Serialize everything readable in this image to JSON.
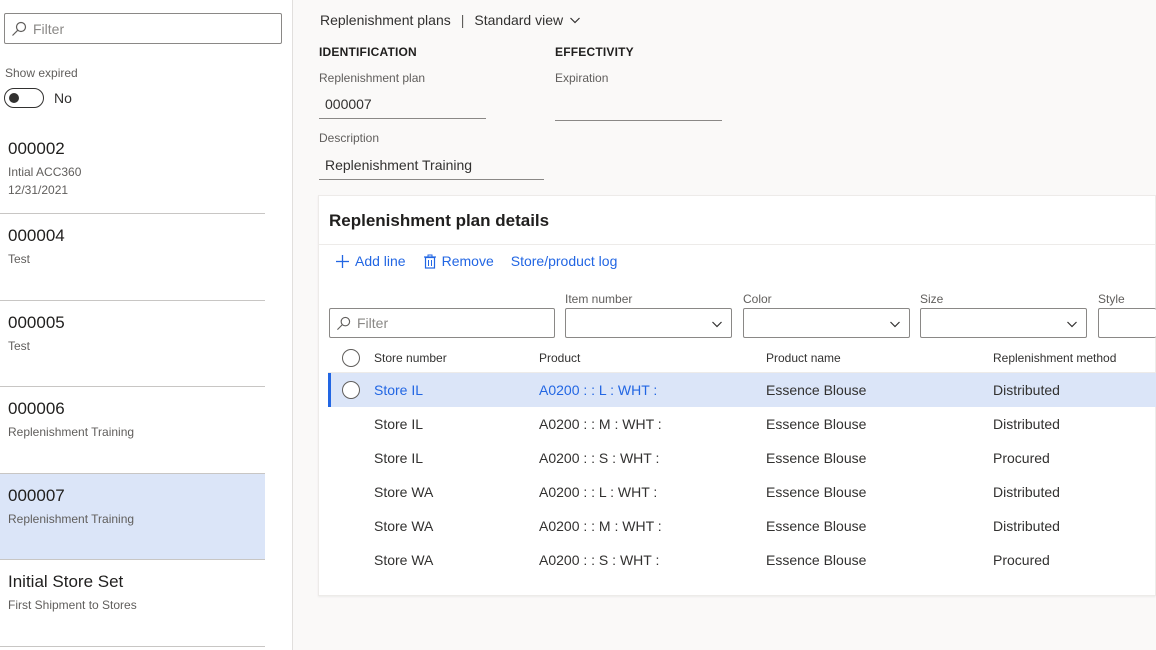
{
  "left_pane": {
    "filter_placeholder": "Filter",
    "show_expired_label": "Show expired",
    "show_expired_value": "No",
    "items": [
      {
        "title": "000002",
        "line1": "Intial ACC360",
        "line2": "12/31/2021"
      },
      {
        "title": "000004",
        "line1": "Test",
        "line2": ""
      },
      {
        "title": "000005",
        "line1": "Test",
        "line2": ""
      },
      {
        "title": "000006",
        "line1": "Replenishment Training",
        "line2": ""
      },
      {
        "title": "000007",
        "line1": "Replenishment Training",
        "line2": ""
      },
      {
        "title": "Initial Store Set",
        "line1": "First Shipment to Stores",
        "line2": ""
      }
    ]
  },
  "header": {
    "breadcrumb": "Replenishment plans",
    "separator": "|",
    "view": "Standard view"
  },
  "form": {
    "identification_head": "IDENTIFICATION",
    "effectivity_head": "EFFECTIVITY",
    "plan_label": "Replenishment plan",
    "plan_value": "000007",
    "expiration_label": "Expiration",
    "expiration_value": "",
    "description_label": "Description",
    "description_value": "Replenishment Training"
  },
  "details": {
    "title": "Replenishment plan details",
    "actions": {
      "add": "Add line",
      "remove": "Remove",
      "log": "Store/product log"
    },
    "filter_placeholder": "Filter",
    "filter_labels": {
      "item_number": "Item number",
      "color": "Color",
      "size": "Size",
      "style": "Style"
    },
    "columns": {
      "store": "Store number",
      "product": "Product",
      "name": "Product name",
      "method": "Replenishment method"
    },
    "rows": [
      {
        "store": "Store IL",
        "product": "A0200 :  : L : WHT :",
        "name": "Essence Blouse",
        "method": "Distributed"
      },
      {
        "store": "Store IL",
        "product": "A0200 :  : M : WHT :",
        "name": "Essence Blouse",
        "method": "Distributed"
      },
      {
        "store": "Store IL",
        "product": "A0200 :  : S : WHT :",
        "name": "Essence Blouse",
        "method": "Procured"
      },
      {
        "store": "Store WA",
        "product": "A0200 :  : L : WHT :",
        "name": "Essence Blouse",
        "method": "Distributed"
      },
      {
        "store": "Store WA",
        "product": "A0200 :  : M : WHT :",
        "name": "Essence Blouse",
        "method": "Distributed"
      },
      {
        "store": "Store WA",
        "product": "A0200 :  : S : WHT :",
        "name": "Essence Blouse",
        "method": "Procured"
      }
    ]
  },
  "colors": {
    "accent": "#2266e3",
    "selected_bg": "#dbe5f8"
  },
  "icons": {
    "search": "search-icon",
    "chevron": "chevron-down-icon",
    "add": "plus-icon",
    "remove": "trash-icon"
  }
}
